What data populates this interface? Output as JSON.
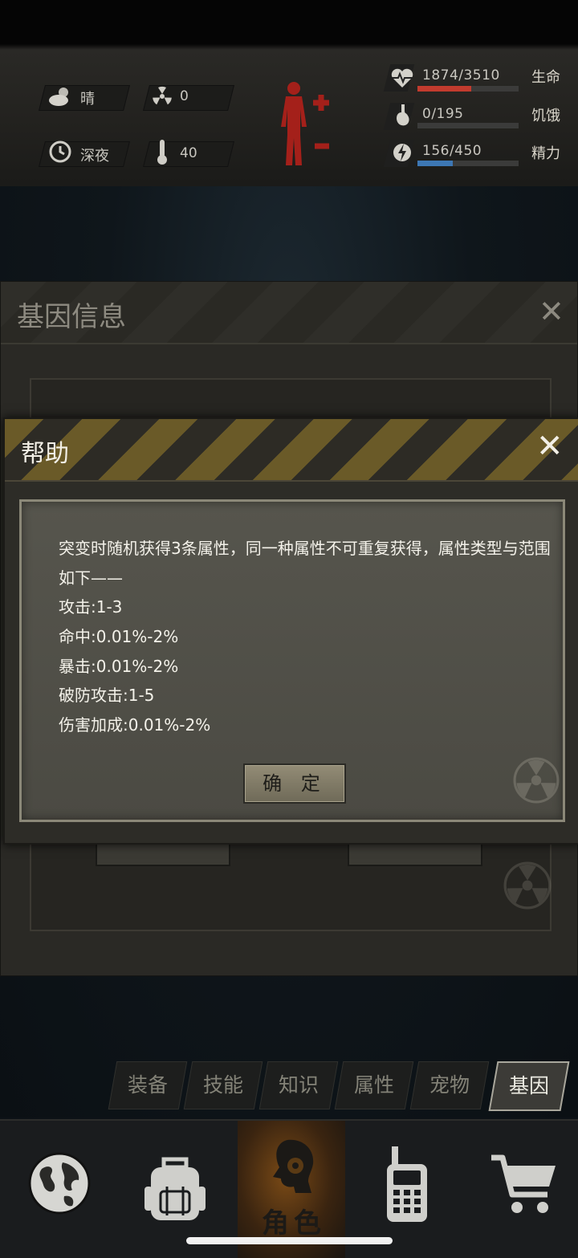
{
  "status": {
    "weather": {
      "icon": "cloud-sun-icon",
      "label": "晴"
    },
    "radiation": {
      "icon": "radiation-icon",
      "value": "0"
    },
    "time_of_day": {
      "icon": "clock-icon",
      "label": "深夜"
    },
    "temperature": {
      "icon": "thermometer-icon",
      "value": "40"
    },
    "body_icon": "human-body-plus-minus-icon",
    "stats": [
      {
        "name": "生命",
        "icon": "heart-pulse-icon",
        "value": "1874/3510",
        "fraction": 0.534,
        "color": "#c23b2e"
      },
      {
        "name": "饥饿",
        "icon": "stomach-icon",
        "value": "0/195",
        "fraction": 0.0,
        "color": "#8a8a86"
      },
      {
        "name": "精力",
        "icon": "energy-icon",
        "value": "156/450",
        "fraction": 0.347,
        "color": "#3d77b4"
      }
    ]
  },
  "gene_panel": {
    "title": "基因信息",
    "close_icon": "close-icon"
  },
  "help_dialog": {
    "title": "帮助",
    "close_icon": "close-icon",
    "lines": [
      "突变时随机获得3条属性，同一种属性不可重复获得，属性类型与范围",
      "如下——",
      "攻击:1-3",
      "命中:0.01%-2%",
      "暴击:0.01%-2%",
      "破防攻击:1-5",
      "伤害加成:0.01%-2%"
    ],
    "confirm_label": "确 定"
  },
  "tabs": [
    {
      "label": "装备",
      "active": false
    },
    {
      "label": "技能",
      "active": false
    },
    {
      "label": "知识",
      "active": false
    },
    {
      "label": "属性",
      "active": false
    },
    {
      "label": "宠物",
      "active": false
    },
    {
      "label": "基因",
      "active": true
    }
  ],
  "bottom_nav": {
    "items": [
      {
        "icon": "globe-icon"
      },
      {
        "icon": "backpack-icon"
      },
      {
        "icon": "character-head-icon",
        "label": "角色"
      },
      {
        "icon": "walkie-talkie-icon"
      },
      {
        "icon": "shopping-cart-icon"
      }
    ]
  }
}
